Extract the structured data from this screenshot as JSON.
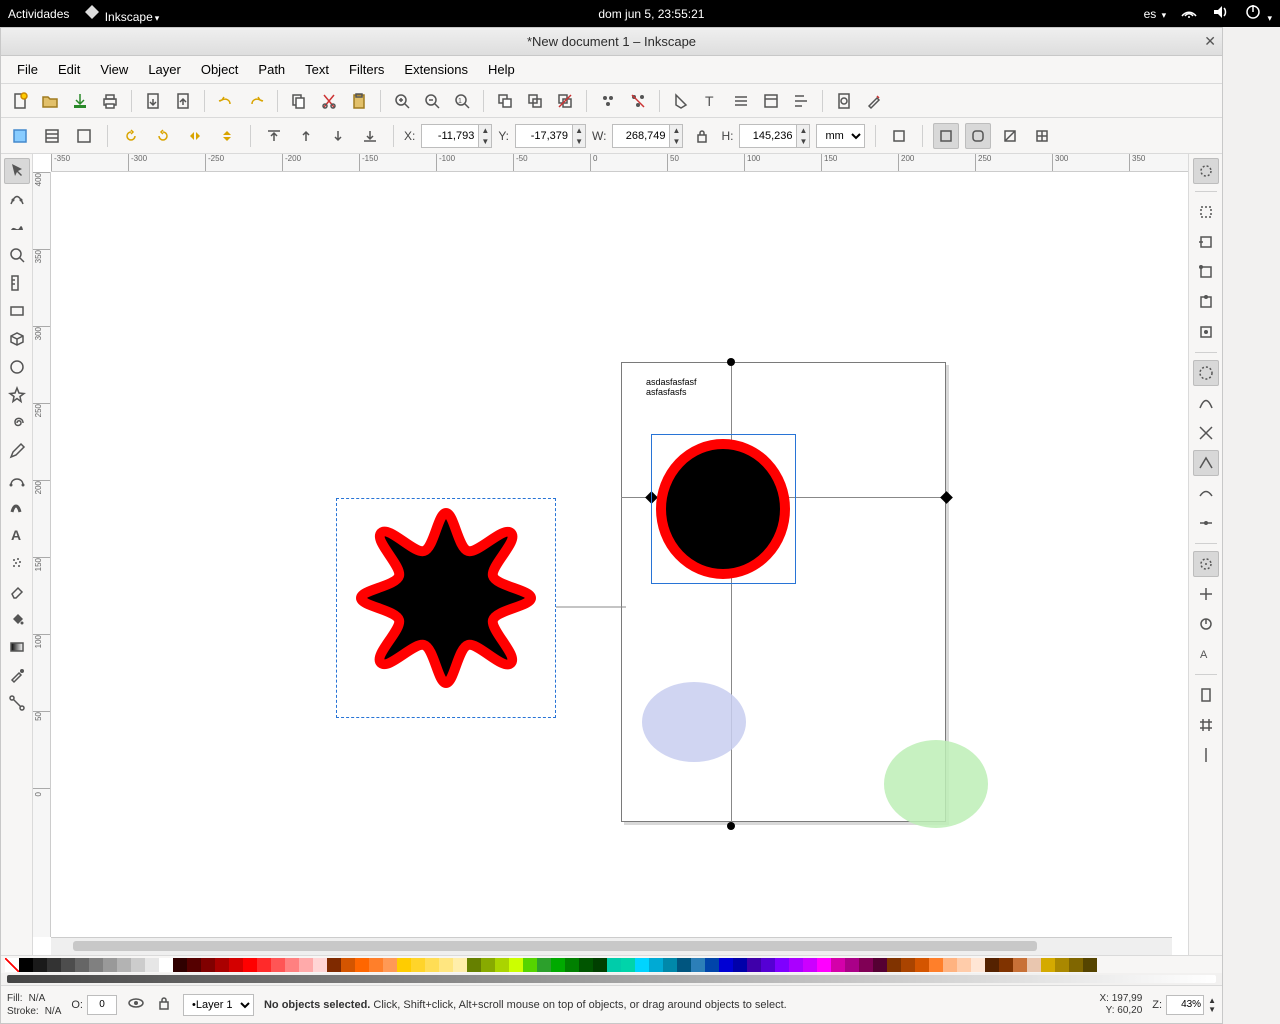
{
  "gnome": {
    "activities": "Actividades",
    "app_menu": "Inkscape",
    "clock": "dom jun  5, 23:55:21",
    "lang": "es"
  },
  "window": {
    "title": "*New document 1 – Inkscape"
  },
  "menus": [
    "File",
    "Edit",
    "View",
    "Layer",
    "Object",
    "Path",
    "Text",
    "Filters",
    "Extensions",
    "Help"
  ],
  "props": {
    "x_label": "X:",
    "x": "-11,793",
    "y_label": "Y:",
    "y": "-17,379",
    "w_label": "W:",
    "w": "268,749",
    "h_label": "H:",
    "h": "145,236",
    "unit": "mm"
  },
  "ruler_h": [
    "-350",
    "-300",
    "-250",
    "-200",
    "-150",
    "-100",
    "-50",
    "0",
    "50",
    "100",
    "150",
    "200",
    "250",
    "300",
    "350"
  ],
  "ruler_v": [
    "400",
    "350",
    "300",
    "250",
    "200",
    "150",
    "100",
    "50",
    "0"
  ],
  "canvas_text": {
    "line1": "asdasfasfasf",
    "line2": "asfasfasfs"
  },
  "palette": [
    "#000000",
    "#1a1a1a",
    "#333333",
    "#4d4d4d",
    "#666666",
    "#808080",
    "#999999",
    "#b3b3b3",
    "#cccccc",
    "#e6e6e6",
    "#ffffff",
    "#2f0000",
    "#550000",
    "#800000",
    "#aa0000",
    "#d40000",
    "#ff0000",
    "#ff2a2a",
    "#ff5555",
    "#ff8080",
    "#ffaaaa",
    "#ffd5d5",
    "#7f2a00",
    "#d45500",
    "#ff6600",
    "#ff7f2a",
    "#ff9955",
    "#ffcc00",
    "#ffd42a",
    "#ffdd55",
    "#ffe680",
    "#ffeeaa",
    "#668000",
    "#88aa00",
    "#aad400",
    "#ccff00",
    "#55d400",
    "#2ca02c",
    "#00aa00",
    "#008000",
    "#005500",
    "#003f00",
    "#00ccaa",
    "#00d4aa",
    "#00d4ff",
    "#00aad4",
    "#0088aa",
    "#00557f",
    "#2c7fb8",
    "#0044aa",
    "#0000d4",
    "#0000aa",
    "#3f00aa",
    "#5500d4",
    "#7f00ff",
    "#aa00ff",
    "#cc00ff",
    "#ff00ff",
    "#d400aa",
    "#aa0088",
    "#800055",
    "#550033",
    "#803300",
    "#aa4400",
    "#d45500",
    "#ff7f2a",
    "#ffb380",
    "#ffccaa",
    "#ffe6d5",
    "#552200",
    "#803300",
    "#c87137",
    "#e9c6af",
    "#d4aa00",
    "#aa8800",
    "#806600",
    "#554400"
  ],
  "status": {
    "fill_label": "Fill:",
    "fill_val": "N/A",
    "stroke_label": "Stroke:",
    "stroke_val": "N/A",
    "opacity_label": "O:",
    "opacity_val": "0",
    "layer": "Layer 1",
    "msg_pre": "No objects selected.",
    "msg_rest": " Click, Shift+click, Alt+scroll mouse on top of objects, or drag around objects to select.",
    "x_label": "X:",
    "x_val": "197,99",
    "y_label": "Y:",
    "y_val": "60,20",
    "z_label": "Z:",
    "zoom": "43%"
  }
}
